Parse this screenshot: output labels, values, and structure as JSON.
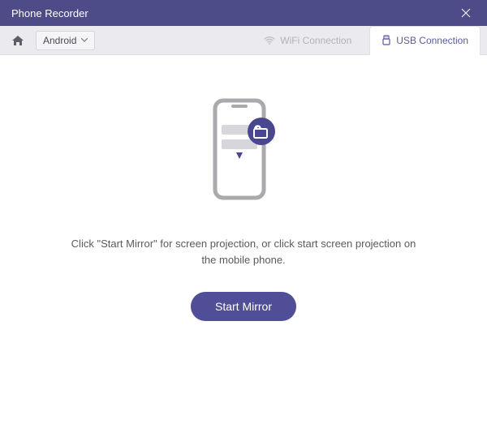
{
  "titlebar": {
    "title": "Phone Recorder"
  },
  "toolbar": {
    "platform_selected": "Android"
  },
  "tabs": {
    "wifi_label": "WiFi Connection",
    "usb_label": "USB Connection"
  },
  "main": {
    "instruction": "Click \"Start Mirror\" for screen projection, or click start screen projection on the mobile phone.",
    "start_button": "Start Mirror"
  },
  "colors": {
    "accent": "#4f4e96",
    "titlebar": "#4d4c89"
  }
}
